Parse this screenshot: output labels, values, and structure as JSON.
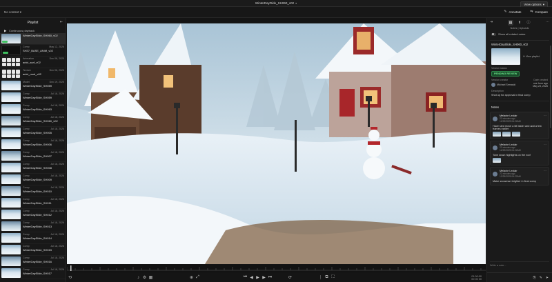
{
  "topbar": {
    "title": "WinterDayRide_SH060_v02",
    "view_options": "View options",
    "annotate": "Annotate",
    "compare": "Compare"
  },
  "context": {
    "label": "No context"
  },
  "playlist": {
    "title": "Playlist",
    "continuous": "Continuous playback",
    "items": [
      {
        "thumb": "snow2",
        "badge": "green",
        "name": "WinterDaySlide_SH060_v02",
        "type": "",
        "date": "",
        "sub": "",
        "active": true
      },
      {
        "thumb": "dark",
        "badge": "green",
        "name": "SH37_BASE_ANIM_v02",
        "type": "Comp",
        "date": "May 12, 2026",
        "sub": "",
        "active": false
      },
      {
        "thumb": "grid",
        "badge": "",
        "name": "anicl_surf_v02",
        "type": "Animation",
        "date": "Dec 06, 2025",
        "sub": "",
        "active": false
      },
      {
        "thumb": "grid",
        "badge": "",
        "name": "anicl_mod_v02",
        "type": "Texture",
        "date": "Dec 06, 2025",
        "sub": "",
        "active": false
      },
      {
        "thumb": "snow",
        "badge": "",
        "name": "WinterDaySlide_SH059",
        "type": "Model",
        "date": "Dec 19, 2025",
        "sub": "",
        "active": false
      },
      {
        "thumb": "snow",
        "badge": "",
        "name": "WinterDaySlide_SH059",
        "type": "Comp",
        "date": "Jul 18, 2026",
        "sub": "",
        "active": false
      },
      {
        "thumb": "snow",
        "badge": "",
        "name": "WinterDaySlide_SH063",
        "type": "Comp",
        "date": "Jul 18, 2026",
        "sub": "",
        "active": false
      },
      {
        "thumb": "snow2",
        "badge": "",
        "name": "WinterDaySlide_SH060_v02",
        "type": "Comp",
        "date": "Jul 18, 2026",
        "sub": "",
        "active": false
      },
      {
        "thumb": "snow",
        "badge": "",
        "name": "WinterDaySlide_SH005",
        "type": "Comp",
        "date": "Jul 18, 2026",
        "sub": "",
        "active": false
      },
      {
        "thumb": "snow",
        "badge": "",
        "name": "WinterDaySlide_SH006",
        "type": "Comp",
        "date": "Jul 18, 2026",
        "sub": "",
        "active": false
      },
      {
        "thumb": "snow2",
        "badge": "",
        "name": "WinterDaySlide_SH007",
        "type": "Comp",
        "date": "Jul 18, 2026",
        "sub": "",
        "active": false
      },
      {
        "thumb": "snow",
        "badge": "",
        "name": "WinterDaySlide_SH008",
        "type": "Comp",
        "date": "Jul 18, 2026",
        "sub": "",
        "active": false
      },
      {
        "thumb": "snow",
        "badge": "",
        "name": "WinterDaySlide_SH009",
        "type": "Comp",
        "date": "Jul 18, 2026",
        "sub": "",
        "active": false
      },
      {
        "thumb": "snow2",
        "badge": "",
        "name": "WinterDaySlide_SH010",
        "type": "Comp",
        "date": "Jul 18, 2026",
        "sub": "",
        "active": false
      },
      {
        "thumb": "snow",
        "badge": "",
        "name": "WinterDaySlide_SH011",
        "type": "Comp",
        "date": "Jul 18, 2026",
        "sub": "",
        "active": false
      },
      {
        "thumb": "snow",
        "badge": "",
        "name": "WinterDaySlide_SH012",
        "type": "Comp",
        "date": "Jul 18, 2026",
        "sub": "",
        "active": false
      },
      {
        "thumb": "snow2",
        "badge": "",
        "name": "WinterDaySlide_SH013",
        "type": "Comp",
        "date": "Jul 18, 2026",
        "sub": "",
        "active": false
      },
      {
        "thumb": "snow",
        "badge": "",
        "name": "WinterDaySlide_SH014",
        "type": "Comp",
        "date": "Jul 18, 2026",
        "sub": "",
        "active": false
      },
      {
        "thumb": "snow",
        "badge": "",
        "name": "WinterDaySlide_SH015",
        "type": "Comp",
        "date": "Jul 18, 2026",
        "sub": "",
        "active": false
      },
      {
        "thumb": "snow2",
        "badge": "",
        "name": "WinterDaySlide_SH016",
        "type": "Comp",
        "date": "Jul 18, 2026",
        "sub": "",
        "active": false
      },
      {
        "thumb": "snow",
        "badge": "",
        "name": "WinterDaySlide_SH017",
        "type": "Comp",
        "date": "Jul 18, 2026",
        "sub": "",
        "active": false
      }
    ]
  },
  "viewer": {
    "alt": "snowy village scene with snowman"
  },
  "panel": {
    "tab_label": "Notes | Uploads",
    "show_all": "Show all related notes",
    "version_name": "WinterDaySlide_SH060_v02",
    "view_playlist": "View playlist",
    "status_label": "Version status",
    "status": "PENDING REVIEW",
    "created_label": "Version creator",
    "created_at_label": "Date created",
    "creator": "Michael Semaski",
    "created_at": "one hour ago",
    "created_date": "May 23, 2026",
    "description_label": "Description",
    "description": "Shot up for approval in final comp",
    "notes_label": "Notes",
    "notes": [
      {
        "name": "Melanie Leclair",
        "time": "22 minutes ago",
        "date": "12/29/2025 04:22AM",
        "text": "Have sled move a bit faster and add a few frames earlier",
        "atts": 3
      },
      {
        "name": "Melanie Leclair",
        "time": "22 minutes ago",
        "date": "12/29/2025 04:22AM",
        "text": "Tone down highlights on the roof",
        "atts": 1
      },
      {
        "name": "Melanie Leclair",
        "time": "22 minutes ago",
        "date": "12/29/2025 04:22AM",
        "text": "Make snowman brighter in final comp",
        "atts": 0
      }
    ],
    "composer_placeholder": "Write a note..."
  },
  "controls": {
    "timecode": "01:00:00",
    "frame": "00 00 00"
  }
}
